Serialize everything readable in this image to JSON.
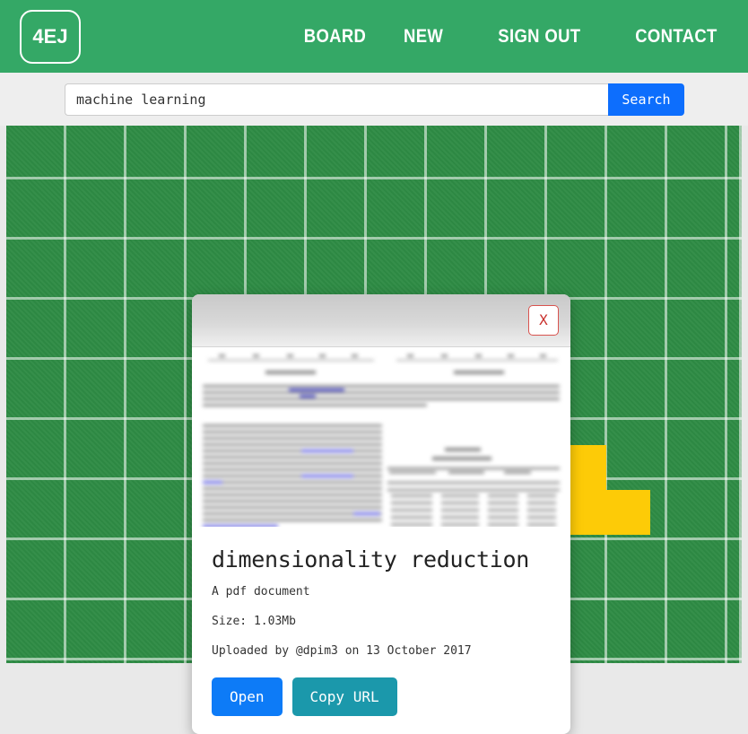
{
  "colors": {
    "brand_green": "#34a866",
    "board_green": "#2e8b44",
    "tile_yellow": "#fdcb07",
    "primary_blue": "#0d6efd",
    "open_blue": "#0d7bf7",
    "copy_teal": "#1b98ab",
    "close_red": "#c9302c"
  },
  "navbar": {
    "brand": "4EJ",
    "links": [
      {
        "label": "BOARD",
        "name": "nav-link-board"
      },
      {
        "label": "NEW",
        "name": "nav-link-new"
      },
      {
        "label": "SIGN OUT",
        "name": "nav-link-sign-out"
      },
      {
        "label": "CONTACT",
        "name": "nav-link-contact"
      }
    ]
  },
  "search": {
    "value": "machine learning",
    "placeholder": "Search",
    "button_label": "Search"
  },
  "board": {
    "tiles": [
      {
        "name": "tile-yellow",
        "color": "#fdcb07"
      }
    ]
  },
  "modal": {
    "close_label": "X",
    "preview_alt": "pdf-page-preview",
    "title": "dimensionality reduction",
    "type_line": "A pdf document",
    "size_line": "Size: 1.03Mb",
    "uploaded_line": "Uploaded by @dpim3 on 13 October 2017",
    "buttons": {
      "open": "Open",
      "copy": "Copy URL"
    }
  }
}
